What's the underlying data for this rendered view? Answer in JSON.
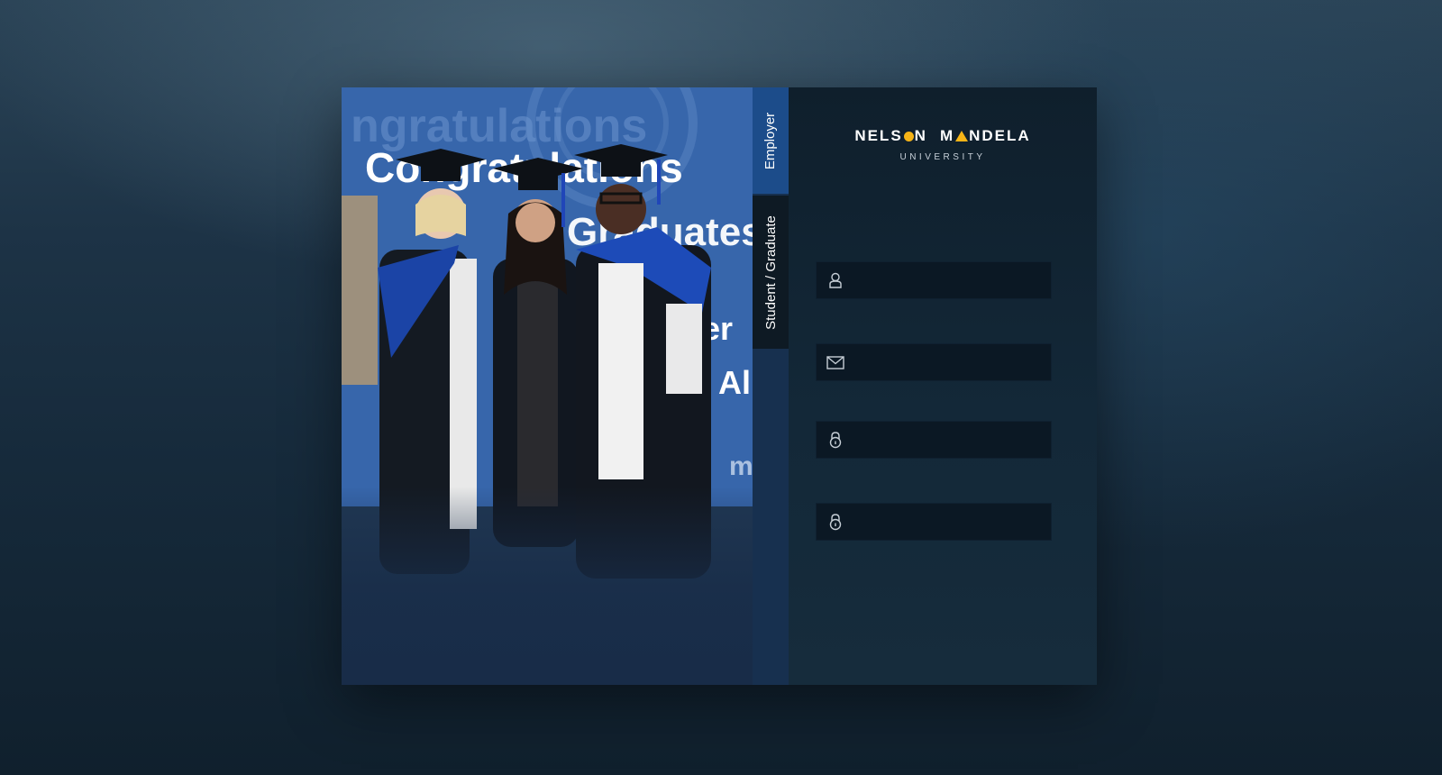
{
  "brand": {
    "name_left_part1": "NELS",
    "name_left_part2": "N",
    "name_right_part1": "M",
    "name_right_part2": "NDELA",
    "subtitle": "UNIVERSITY",
    "accent_color": "#f6b417"
  },
  "tabs": [
    {
      "label": "Employer",
      "active": false
    },
    {
      "label": "Student / Graduate",
      "active": true
    }
  ],
  "photo": {
    "banner_text": [
      "Congratulations",
      "Graduates",
      "Alumni"
    ]
  },
  "form": {
    "fields": [
      {
        "icon": "user-icon",
        "value": "",
        "placeholder": ""
      },
      {
        "icon": "mail-icon",
        "value": "",
        "placeholder": ""
      },
      {
        "icon": "lock-icon",
        "value": "",
        "placeholder": ""
      },
      {
        "icon": "lock-icon",
        "value": "",
        "placeholder": ""
      }
    ]
  }
}
